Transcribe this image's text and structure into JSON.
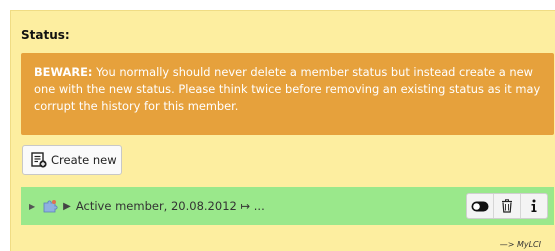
{
  "status_section": {
    "title": "Status:",
    "warning": {
      "label": "BEWARE:",
      "text": " You normally should never delete a member status but instead create a new one with the new status. Please think twice before removing an existing status as it may corrupt the history for this member."
    },
    "create_button_label": "Create new"
  },
  "member_row": {
    "label": "Active member, 20.08.2012 ↦ ...",
    "row_color": "#9ae88b",
    "icons": [
      "tree-caret-icon",
      "puzzle-icon",
      "expand-caret-icon"
    ],
    "actions": [
      "toggle-icon",
      "trash-icon",
      "info-icon"
    ]
  },
  "footer": {
    "text": "—> MyLCI"
  },
  "colors": {
    "panel": "#fdeea0",
    "warning": "#e6a13c",
    "accent_green": "#9ae88b"
  }
}
